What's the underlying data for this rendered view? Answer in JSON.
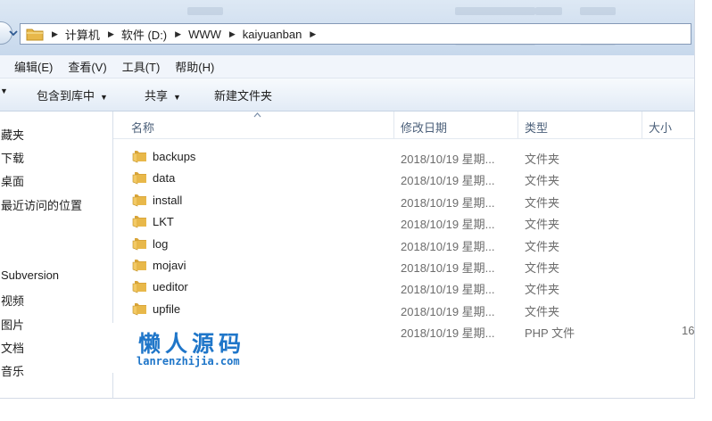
{
  "breadcrumb": [
    "计算机",
    "软件 (D:)",
    "WWW",
    "kaiyuanban"
  ],
  "menu": [
    "编辑(E)",
    "查看(V)",
    "工具(T)",
    "帮助(H)"
  ],
  "commands": [
    "包含到库中",
    "共享",
    "新建文件夹"
  ],
  "nav_items": [
    "藏夹",
    "下载",
    "桌面",
    "最近访问的位置",
    "Subversion",
    "视频",
    "图片",
    "文档",
    "音乐"
  ],
  "columns": {
    "name": "名称",
    "date": "修改日期",
    "type": "类型",
    "size": "大小"
  },
  "files": [
    {
      "name": "backups",
      "date": "2018/10/19 星期...",
      "type": "文件夹",
      "size": ""
    },
    {
      "name": "data",
      "date": "2018/10/19 星期...",
      "type": "文件夹",
      "size": ""
    },
    {
      "name": "install",
      "date": "2018/10/19 星期...",
      "type": "文件夹",
      "size": ""
    },
    {
      "name": "LKT",
      "date": "2018/10/19 星期...",
      "type": "文件夹",
      "size": ""
    },
    {
      "name": "log",
      "date": "2018/10/19 星期...",
      "type": "文件夹",
      "size": ""
    },
    {
      "name": "mojavi",
      "date": "2018/10/19 星期...",
      "type": "文件夹",
      "size": ""
    },
    {
      "name": "ueditor",
      "date": "2018/10/19 星期...",
      "type": "文件夹",
      "size": ""
    },
    {
      "name": "upfile",
      "date": "2018/10/19 星期...",
      "type": "文件夹",
      "size": ""
    },
    {
      "name": "",
      "date": "2018/10/19 星期...",
      "type": "PHP 文件",
      "size": "16"
    }
  ],
  "watermark": {
    "title": "懒人源码",
    "subtitle": "lanrenzhijia.com"
  },
  "colors": {
    "folder": "#e8b84a",
    "header_text": "#4c607a",
    "watermark": "#1f76c9"
  }
}
